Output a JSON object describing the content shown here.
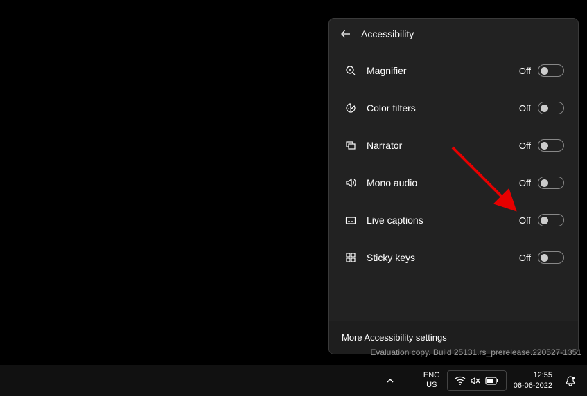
{
  "panel": {
    "title": "Accessibility",
    "items": [
      {
        "label": "Magnifier",
        "status": "Off"
      },
      {
        "label": "Color filters",
        "status": "Off"
      },
      {
        "label": "Narrator",
        "status": "Off"
      },
      {
        "label": "Mono audio",
        "status": "Off"
      },
      {
        "label": "Live captions",
        "status": "Off"
      },
      {
        "label": "Sticky keys",
        "status": "Off"
      }
    ],
    "footer": "More Accessibility settings"
  },
  "watermark": "Evaluation copy. Build 25131.rs_prerelease.220527-1351",
  "taskbar": {
    "lang1": "ENG",
    "lang2": "US",
    "time": "12:55",
    "date": "06-06-2022"
  }
}
